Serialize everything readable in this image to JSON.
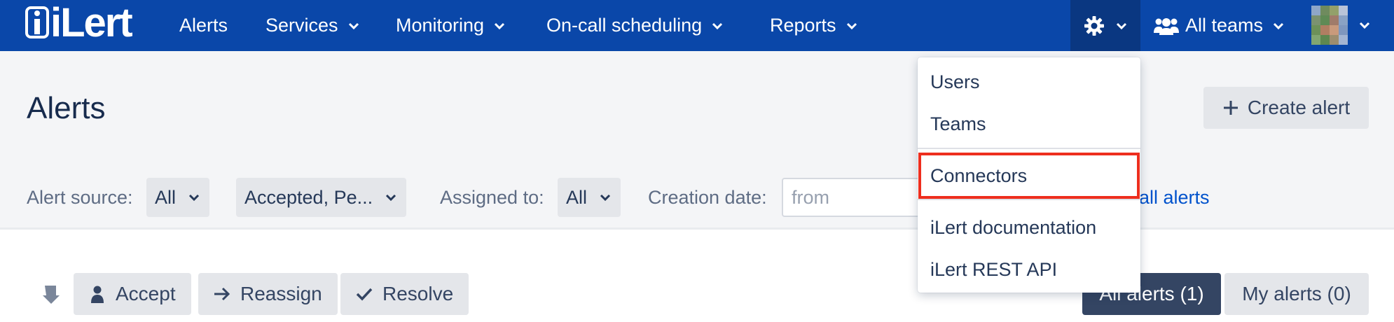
{
  "nav": {
    "logo_text": "iLert",
    "items": [
      {
        "label": "Alerts",
        "has_menu": false
      },
      {
        "label": "Services",
        "has_menu": true
      },
      {
        "label": "Monitoring",
        "has_menu": true
      },
      {
        "label": "On-call scheduling",
        "has_menu": true
      },
      {
        "label": "Reports",
        "has_menu": true
      }
    ],
    "settings_icon": "gear-icon",
    "teams_label": "All teams",
    "teams_icon": "users-icon"
  },
  "page": {
    "title": "Alerts",
    "create_label": "Create alert"
  },
  "filters": {
    "source_label": "Alert source:",
    "source_value": "All",
    "status_value": "Accepted, Pe...",
    "assigned_label": "Assigned to:",
    "assigned_value": "All",
    "date_label": "Creation date:",
    "date_placeholder": "from",
    "all_alerts_link": "all alerts"
  },
  "actions": {
    "accept_label": "Accept",
    "reassign_label": "Reassign",
    "resolve_label": "Resolve"
  },
  "tabs": {
    "all_label": "All alerts (1)",
    "my_label": "My alerts (0)"
  },
  "settings_menu": {
    "items": [
      {
        "label": "Users"
      },
      {
        "label": "Teams"
      },
      {
        "label": "Connectors",
        "highlighted": true
      },
      {
        "label": "iLert documentation"
      },
      {
        "label": "iLert REST API"
      }
    ]
  },
  "colors": {
    "nav_bg": "#0a47a9",
    "active_nav_bg": "#0a3781",
    "highlight_border": "#ee2e1e",
    "link": "#0052cc"
  }
}
